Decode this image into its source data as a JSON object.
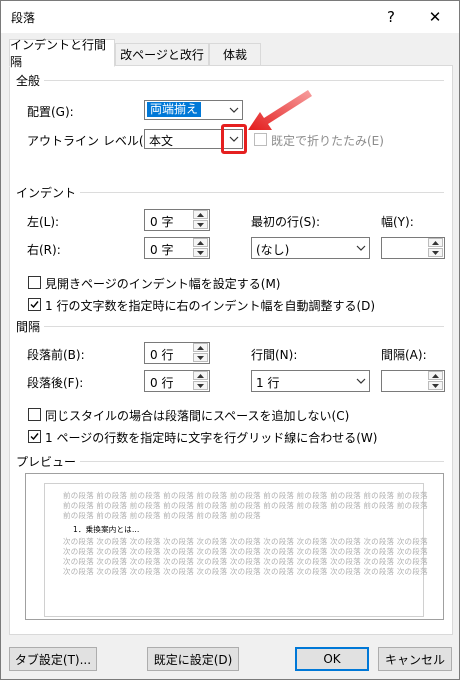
{
  "window": {
    "title": "段落",
    "help_label": "?",
    "close_label": "✕"
  },
  "tabs": [
    {
      "label": "インデントと行間隔"
    },
    {
      "label": "改ページと改行"
    },
    {
      "label": "体裁"
    }
  ],
  "general": {
    "group_title": "全般",
    "alignment_label": "配置(G):",
    "alignment_value": "両端揃え",
    "outline_label": "アウトライン レベル(O):",
    "outline_value": "本文",
    "collapse_label": "既定で折りたたみ(E)"
  },
  "indent": {
    "group_title": "インデント",
    "left_label": "左(L):",
    "left_value": "0 字",
    "right_label": "右(R):",
    "right_value": "0 字",
    "first_line_label": "最初の行(S):",
    "first_line_value": "(なし)",
    "width_label": "幅(Y):",
    "width_value": "",
    "mirror_label": "見開きページのインデント幅を設定する(M)",
    "auto_adjust_label": "1 行の文字数を指定時に右のインデント幅を自動調整する(D)"
  },
  "spacing": {
    "group_title": "間隔",
    "before_label": "段落前(B):",
    "before_value": "0 行",
    "after_label": "段落後(F):",
    "after_value": "0 行",
    "line_label": "行間(N):",
    "line_value": "1 行",
    "at_label": "間隔(A):",
    "at_value": "",
    "no_space_same_style_label": "同じスタイルの場合は段落間にスペースを追加しない(C)",
    "snap_grid_label": "1 ページの行数を指定時に文字を行グリッド線に合わせる(W)"
  },
  "preview": {
    "group_title": "プレビュー",
    "prev_lines": [
      "前の段落 前の段落 前の段落 前の段落 前の段落 前の段落 前の段落 前の段落 前の段落 前の段落 前の段落",
      "前の段落 前の段落 前の段落 前の段落 前の段落 前の段落 前の段落 前の段落 前の段落 前の段落 前の段落",
      "前の段落 前の段落 前の段落 前の段落 前の段落 前の段落"
    ],
    "current_line": "1．乗換案内とは…",
    "next_lines": [
      "次の段落 次の段落 次の段落 次の段落 次の段落 次の段落 次の段落 次の段落 次の段落 次の段落 次の段落",
      "次の段落 次の段落 次の段落 次の段落 次の段落 次の段落 次の段落 次の段落 次の段落 次の段落 次の段落",
      "次の段落 次の段落 次の段落 次の段落 次の段落 次の段落 次の段落 次の段落 次の段落 次の段落 次の段落",
      "次の段落 次の段落 次の段落 次の段落 次の段落 次の段落 次の段落 次の段落 次の段落 次の段落 次の段落"
    ]
  },
  "buttons": {
    "tabs_label": "タブ設定(T)...",
    "default_label": "既定に設定(D)",
    "ok_label": "OK",
    "cancel_label": "キャンセル"
  },
  "colors": {
    "accent": "#0078d7",
    "highlight": "#e52020"
  }
}
